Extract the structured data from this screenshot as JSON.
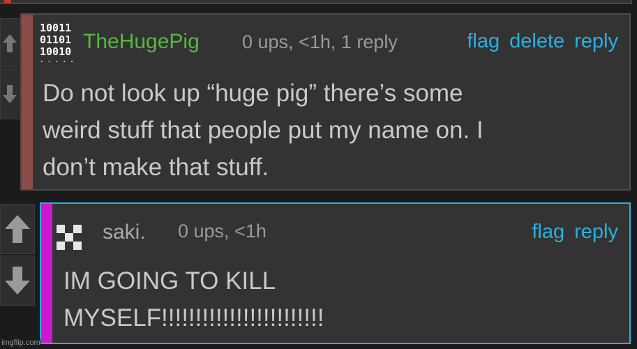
{
  "comments": [
    {
      "username": "TheHugePig",
      "avatar_icon": "binary-digits-avatar",
      "meta": "0 ups, <1h, 1 reply",
      "actions": {
        "flag": "flag",
        "delete": "delete",
        "reply": "reply"
      },
      "body": "Do not look up “huge pig” there’s some\nweird stuff that people put my name on. I\ndon’t make that stuff.",
      "username_color": "#55b83f",
      "side_color": "#8c4c47"
    },
    {
      "username": "saki.",
      "avatar_icon": "checkered-avatar",
      "meta": "0 ups, <1h",
      "actions": {
        "flag": "flag",
        "reply": "reply"
      },
      "body": "IM GOING TO KILL\nMYSELF!!!!!!!!!!!!!!!!!!!!!!!!",
      "username_color": "#a8a8a8",
      "side_color": "#ce17cf",
      "border_color": "#27b0dd"
    }
  ],
  "vote_icons": {
    "up": "up-arrow-icon",
    "down": "down-arrow-icon"
  },
  "watermark": "imgflip.com"
}
